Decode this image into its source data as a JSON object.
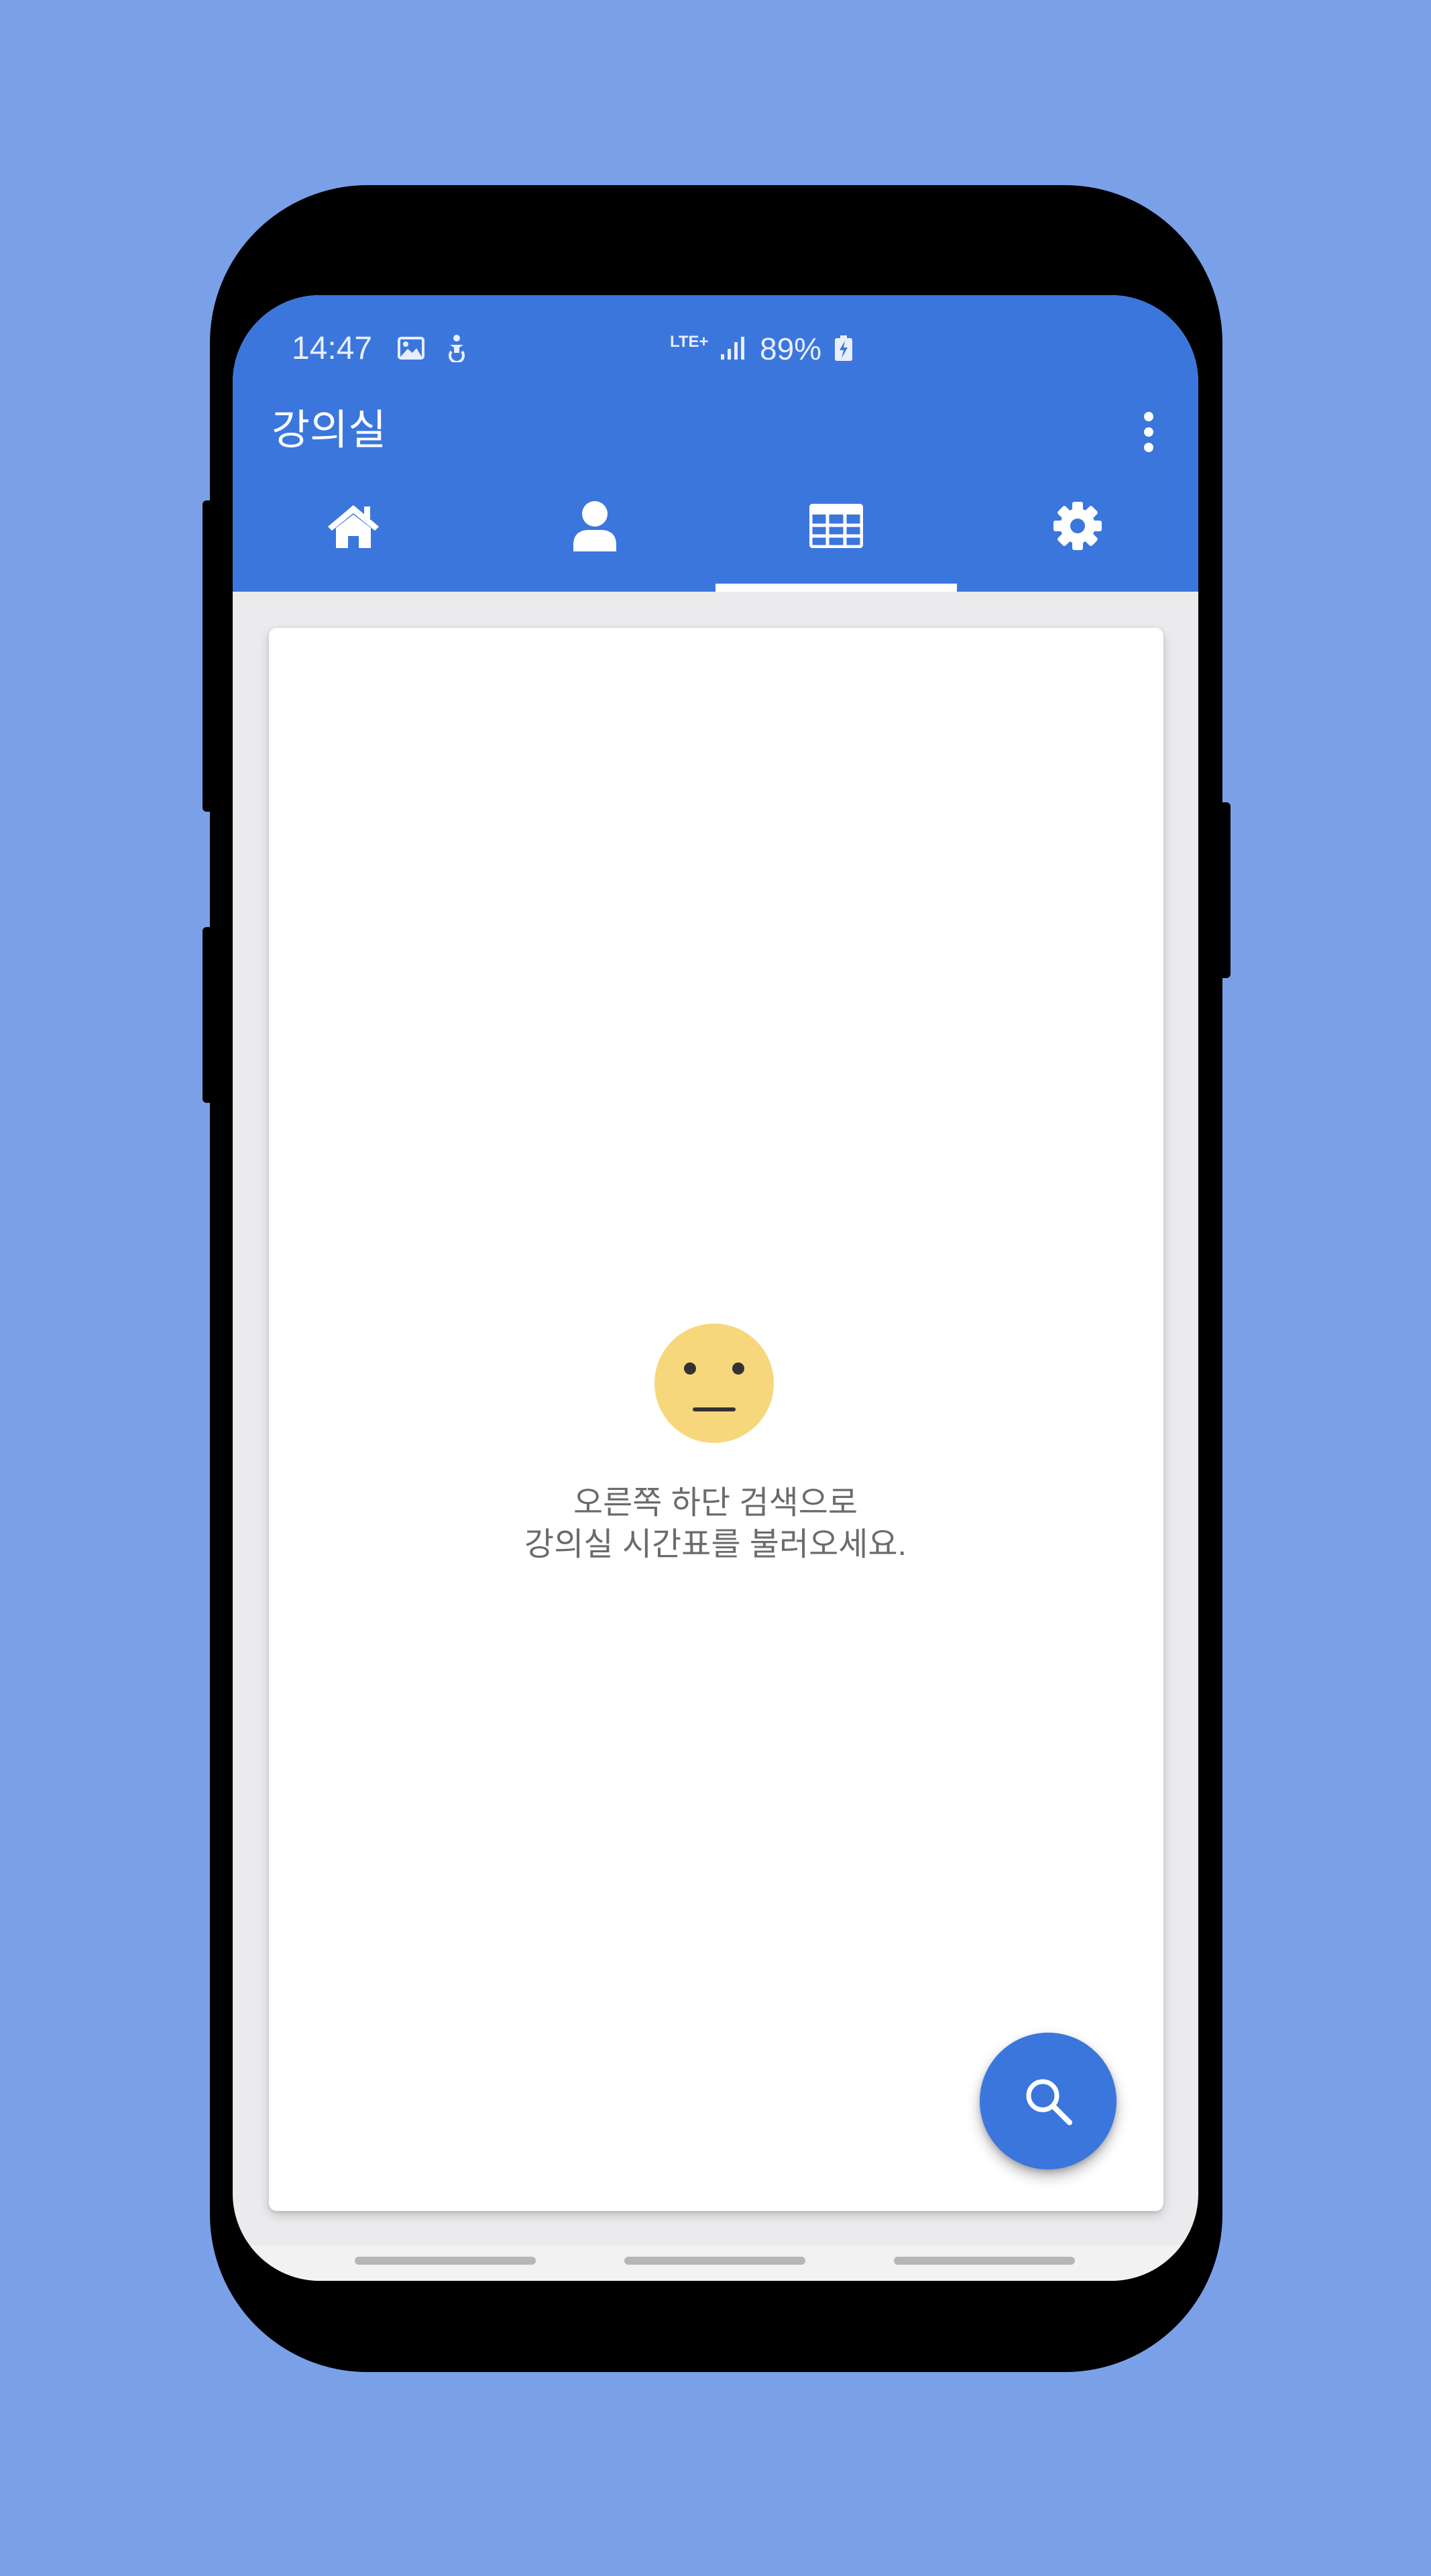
{
  "status_bar": {
    "time": "14:47",
    "icons": [
      "image-icon",
      "accessibility-icon"
    ],
    "network": "LTE+",
    "battery_percent": "89%"
  },
  "appbar": {
    "title": "강의실",
    "menu_icon": "more-vert-icon",
    "color": "#3b76dd"
  },
  "tabs": [
    {
      "icon": "home-icon",
      "selected": false
    },
    {
      "icon": "person-icon",
      "selected": false
    },
    {
      "icon": "table-icon",
      "selected": true
    },
    {
      "icon": "gear-icon",
      "selected": false
    }
  ],
  "empty_state": {
    "icon": "neutral-face-icon",
    "line1": "오른쪽 하단 검색으로",
    "line2": "강의실 시간표를 불러오세요.",
    "face_color": "#f7d77b"
  },
  "fab": {
    "icon": "search-icon"
  },
  "background_color": "#7aa0e8"
}
